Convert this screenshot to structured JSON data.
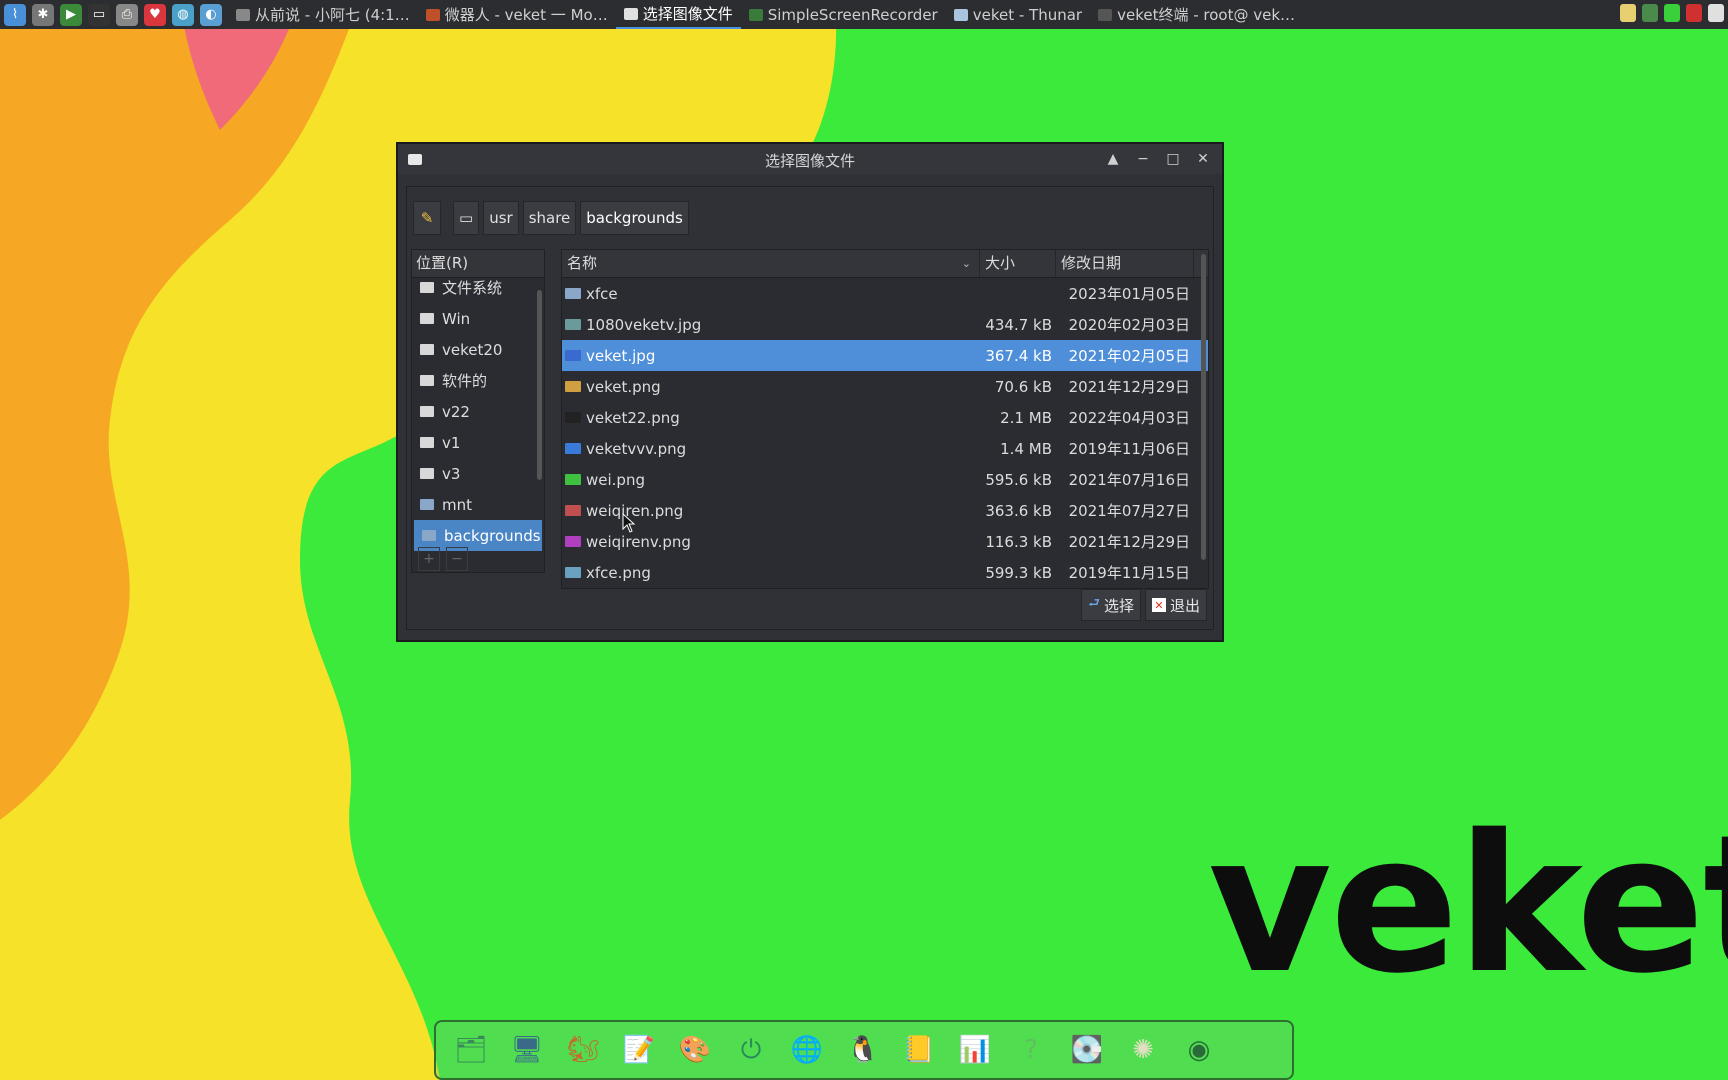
{
  "taskbar": {
    "launchers": [
      {
        "icon": "activity-monitor-icon",
        "color": "#4a90d9",
        "glyph": "⌇"
      },
      {
        "icon": "spider-icon",
        "color": "#777777",
        "glyph": "✱"
      },
      {
        "icon": "play-icon",
        "color": "#3a8a3a",
        "glyph": "▶"
      },
      {
        "icon": "terminal-icon",
        "color": "#333333",
        "glyph": "▭"
      },
      {
        "icon": "printer-icon",
        "color": "#888888",
        "glyph": "⎙"
      },
      {
        "icon": "heart-icon",
        "color": "#d9363e",
        "glyph": "♥"
      },
      {
        "icon": "bird-icon",
        "color": "#4aa0c8",
        "glyph": "◍"
      },
      {
        "icon": "globe-icon",
        "color": "#5a9fd4",
        "glyph": "◐"
      }
    ],
    "tasks": [
      {
        "label": "从前说 - 小阿七 (4:1…",
        "icon_color": "#888888",
        "active": false
      },
      {
        "label": "微器人 - veket 一 Mo…",
        "icon_color": "#c0502a",
        "active": false
      },
      {
        "label": "选择图像文件",
        "icon_color": "#e0e0e0",
        "active": true
      },
      {
        "label": "SimpleScreenRecorder",
        "icon_color": "#3a7a3a",
        "active": false
      },
      {
        "label": "veket - Thunar",
        "icon_color": "#aac4e0",
        "active": false
      },
      {
        "label": "veket终端 - root@ vek…",
        "icon_color": "#555555",
        "active": false
      }
    ],
    "tray_colors": [
      "#e8d070",
      "#4a8a4a",
      "#3ad03a",
      "#d03030",
      "#e0e0e0"
    ]
  },
  "dialog": {
    "title": "选择图像文件",
    "controls": {
      "shade": "▲",
      "minimize": "−",
      "maximize": "□",
      "close": "✕"
    },
    "pathbar": {
      "edit_icon": "✎",
      "root_icon": "▭",
      "segments": [
        "usr",
        "share",
        "backgrounds"
      ]
    },
    "places": {
      "header": "位置(R)",
      "items": [
        {
          "label": "文件系统",
          "type": "drive",
          "selected": false
        },
        {
          "label": "Win",
          "type": "drive",
          "selected": false
        },
        {
          "label": "veket20",
          "type": "drive",
          "selected": false
        },
        {
          "label": "软件的",
          "type": "drive",
          "selected": false
        },
        {
          "label": "v22",
          "type": "drive",
          "selected": false
        },
        {
          "label": "v1",
          "type": "drive",
          "selected": false
        },
        {
          "label": "v3",
          "type": "drive",
          "selected": false
        },
        {
          "label": "mnt",
          "type": "folder",
          "selected": false
        },
        {
          "label": "backgrounds",
          "type": "folder",
          "selected": true
        }
      ],
      "add_label": "+",
      "remove_label": "−"
    },
    "files": {
      "columns": {
        "name": "名称",
        "size": "大小",
        "date": "修改日期"
      },
      "rows": [
        {
          "name": "xfce",
          "size": "",
          "date": "2023年01月05日",
          "icon_color": "#8aa6c8",
          "selected": false
        },
        {
          "name": "1080veketv.jpg",
          "size": "434.7 kB",
          "date": "2020年02月03日",
          "icon_color": "#6a9a9a",
          "selected": false
        },
        {
          "name": "veket.jpg",
          "size": "367.4 kB",
          "date": "2021年02月05日",
          "icon_color": "#3a6ad0",
          "selected": true
        },
        {
          "name": "veket.png",
          "size": "70.6 kB",
          "date": "2021年12月29日",
          "icon_color": "#d0a040",
          "selected": false
        },
        {
          "name": "veket22.png",
          "size": "2.1 MB",
          "date": "2022年04月03日",
          "icon_color": "#222222",
          "selected": false
        },
        {
          "name": "veketvvv.png",
          "size": "1.4 MB",
          "date": "2019年11月06日",
          "icon_color": "#3a7ad8",
          "selected": false
        },
        {
          "name": "wei.png",
          "size": "595.6 kB",
          "date": "2021年07月16日",
          "icon_color": "#40c040",
          "selected": false
        },
        {
          "name": "weiqiren.png",
          "size": "363.6 kB",
          "date": "2021年07月27日",
          "icon_color": "#c05050",
          "selected": false
        },
        {
          "name": "weiqirenv.png",
          "size": "116.3 kB",
          "date": "2021年12月29日",
          "icon_color": "#b040c0",
          "selected": false
        },
        {
          "name": "xfce.png",
          "size": "599.3 kB",
          "date": "2019年11月15日",
          "icon_color": "#6aa0c0",
          "selected": false
        }
      ]
    },
    "actions": {
      "select_label": "选择",
      "cancel_label": "退出"
    }
  },
  "wallpaper": {
    "word": "veket",
    "colors": {
      "green": "#3bea3b",
      "yellow": "#f7e22a",
      "orange": "#f6a825",
      "pink": "#f06a7a"
    }
  },
  "dock": {
    "items": [
      {
        "icon": "file-manager-icon",
        "glyph": "🗂",
        "color": "#3a8a5a"
      },
      {
        "icon": "desktop-icon",
        "glyph": "🖥",
        "color": "#3a6a8a"
      },
      {
        "icon": "squirrel-icon",
        "glyph": "🐿",
        "color": "#c0702a"
      },
      {
        "icon": "notes-icon",
        "glyph": "📝",
        "color": "#8ab0d0"
      },
      {
        "icon": "paint-icon",
        "glyph": "🎨",
        "color": "#d0a040"
      },
      {
        "icon": "power-icon",
        "glyph": "⏻",
        "color": "#2a8a5a"
      },
      {
        "icon": "network-icon",
        "glyph": "🌐",
        "color": "#3a7ab0"
      },
      {
        "icon": "penguin-icon",
        "glyph": "🐧",
        "color": "#222222"
      },
      {
        "icon": "book-icon",
        "glyph": "📒",
        "color": "#d0b020"
      },
      {
        "icon": "chart-icon",
        "glyph": "📊",
        "color": "#c04040"
      },
      {
        "icon": "help-icon",
        "glyph": "?",
        "color": "#60c060"
      },
      {
        "icon": "drive-icon",
        "glyph": "💽",
        "color": "#888888"
      },
      {
        "icon": "settings-icon",
        "glyph": "✺",
        "color": "#e0e0c0"
      },
      {
        "icon": "browser-icon",
        "glyph": "◉",
        "color": "#2a6a3a"
      }
    ]
  }
}
